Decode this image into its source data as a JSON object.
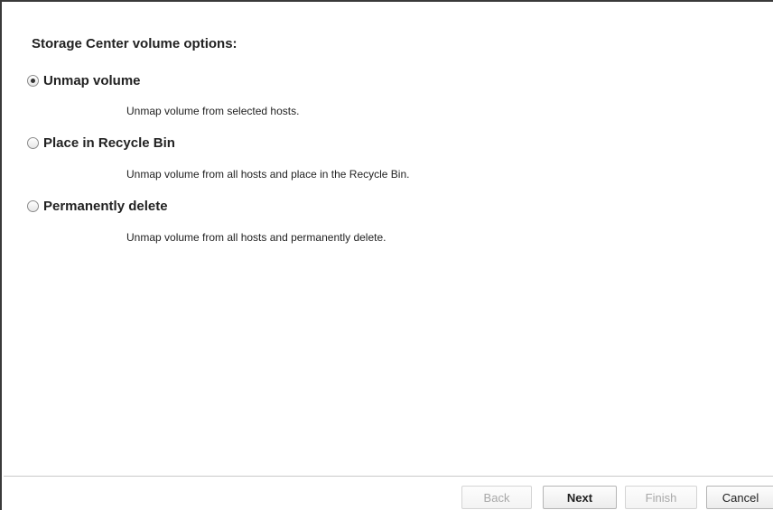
{
  "heading": "Storage Center volume options:",
  "options": [
    {
      "label": "Unmap volume",
      "description": "Unmap volume from selected hosts.",
      "selected": true
    },
    {
      "label": "Place in Recycle Bin",
      "description": "Unmap volume from all hosts and place in the Recycle Bin.",
      "selected": false
    },
    {
      "label": "Permanently delete",
      "description": "Unmap volume from all hosts and permanently delete.",
      "selected": false
    }
  ],
  "buttons": {
    "back": "Back",
    "next": "Next",
    "finish": "Finish",
    "cancel": "Cancel"
  }
}
